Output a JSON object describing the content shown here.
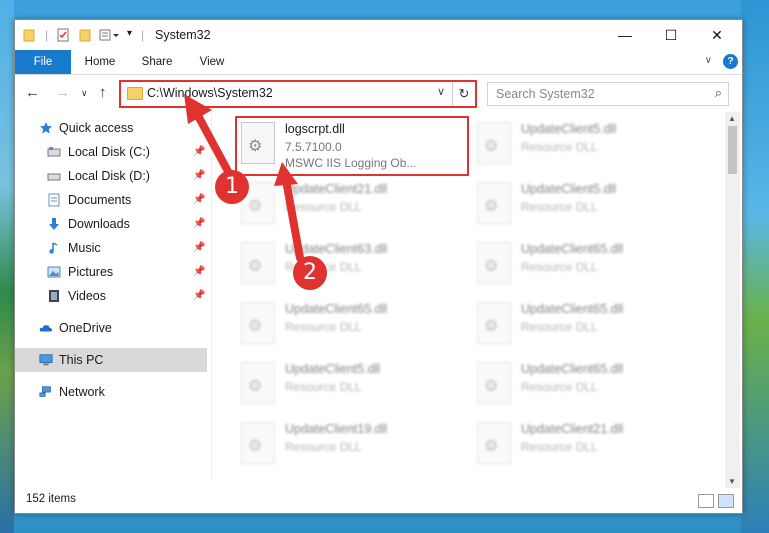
{
  "window": {
    "title": "System32",
    "controls": {
      "minimize": "—",
      "maximize": "☐",
      "close": "✕"
    }
  },
  "quick_access_toolbar": {
    "icons": [
      "folder-icon",
      "properties-icon",
      "new-folder-icon",
      "customize-icon"
    ],
    "separator": "|"
  },
  "ribbon": {
    "tabs": [
      {
        "label": "File"
      },
      {
        "label": "Home"
      },
      {
        "label": "Share"
      },
      {
        "label": "View"
      }
    ],
    "collapse_glyph": "∨",
    "help_glyph": "?"
  },
  "navigation": {
    "back": "←",
    "forward": "→",
    "recent": "∨",
    "up": "↑",
    "address": "C:\\Windows\\System32",
    "dropdown_glyph": "∨",
    "refresh_glyph": "↻",
    "search_placeholder": "Search System32",
    "search_glyph": "⌕"
  },
  "nav_pane": {
    "pin_glyph": "📌",
    "items": [
      {
        "label": "Quick access",
        "icon": "star-icon",
        "pinned": false
      },
      {
        "label": "Local Disk (C:)",
        "icon": "drive-icon",
        "pinned": true
      },
      {
        "label": "Local Disk (D:)",
        "icon": "drive-icon",
        "pinned": true
      },
      {
        "label": "Documents",
        "icon": "documents-icon",
        "pinned": true
      },
      {
        "label": "Downloads",
        "icon": "downloads-icon",
        "pinned": true
      },
      {
        "label": "Music",
        "icon": "music-icon",
        "pinned": true
      },
      {
        "label": "Pictures",
        "icon": "pictures-icon",
        "pinned": true
      },
      {
        "label": "Videos",
        "icon": "videos-icon",
        "pinned": true
      },
      {
        "label": "OneDrive",
        "icon": "cloud-icon",
        "pinned": false
      },
      {
        "label": "This PC",
        "icon": "computer-icon",
        "pinned": false,
        "selected": true
      },
      {
        "label": "Network",
        "icon": "network-icon",
        "pinned": false
      }
    ]
  },
  "files": {
    "left_column": [
      {
        "name": "logscrpt.dll",
        "version": "7.5.7100.0",
        "description": "MSWC IIS Logging Ob...",
        "highlighted": true
      },
      {
        "name": "UpdateClient21.dll",
        "type": "Resource DLL"
      },
      {
        "name": "UpdateClient63.dll",
        "type": "Resource DLL"
      },
      {
        "name": "UpdateClient65.dll",
        "type": "Resource DLL"
      },
      {
        "name": "UpdateClient5.dll",
        "type": "Resource DLL"
      },
      {
        "name": "UpdateClient19.dll",
        "type": "Resource DLL"
      }
    ],
    "right_column": [
      {
        "name": "UpdateClient5.dll",
        "type": "Resource DLL"
      },
      {
        "name": "UpdateClient5.dll",
        "type": "Resource DLL"
      },
      {
        "name": "UpdateClient65.dll",
        "type": "Resource DLL"
      },
      {
        "name": "UpdateClient65.dll",
        "type": "Resource DLL"
      },
      {
        "name": "UpdateClient65.dll",
        "type": "Resource DLL"
      },
      {
        "name": "UpdateClient21.dll",
        "type": "Resource DLL"
      }
    ]
  },
  "status": {
    "item_count": "152 items"
  },
  "callouts": [
    {
      "label": "1"
    },
    {
      "label": "2"
    }
  ],
  "colors": {
    "accent": "#1979ca",
    "callout": "#e0322f",
    "selected": "#d9d9d9"
  }
}
